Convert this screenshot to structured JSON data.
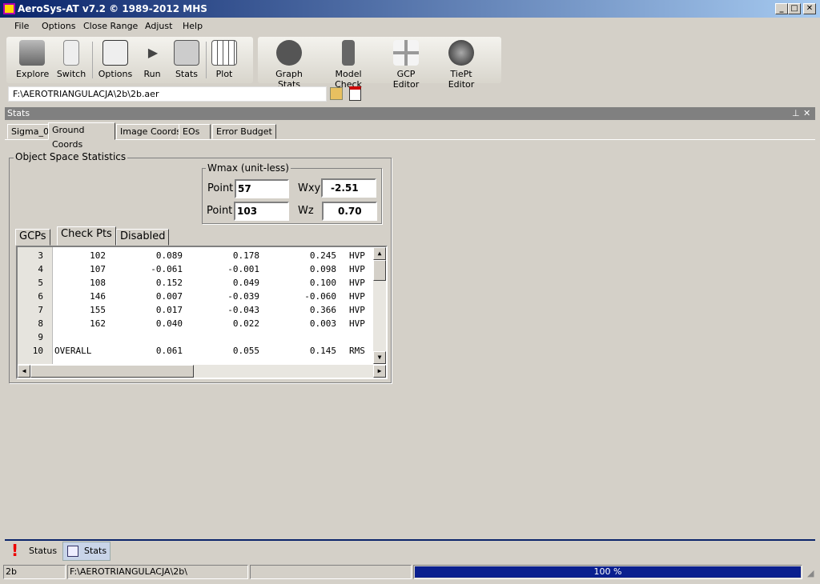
{
  "window": {
    "title": "AeroSys-AT  v7.2 © 1989-2012 MHS",
    "controls": [
      "_",
      "□",
      "✕"
    ]
  },
  "menu": [
    "File",
    "Options",
    "Close Range",
    "Adjust",
    "Help"
  ],
  "toolbar1": [
    {
      "label": "Explore",
      "icon": "computer-icon"
    },
    {
      "label": "Switch",
      "icon": "switch-icon"
    },
    {
      "label": "Options",
      "icon": "checklist-icon"
    },
    {
      "label": "Run",
      "icon": "play-icon"
    },
    {
      "label": "Stats",
      "icon": "magnifier-icon"
    },
    {
      "label": "Plot",
      "icon": "grid-icon"
    }
  ],
  "toolbar2": [
    {
      "label": "Graph Stats",
      "icon": "pie-chart-icon"
    },
    {
      "label": "Model Check",
      "icon": "shield-icon"
    },
    {
      "label": "GCP Editor",
      "icon": "crosshair-icon"
    },
    {
      "label": "TiePt Editor",
      "icon": "tiepoint-icon"
    }
  ],
  "address": "F:\\AEROTRIANGULACJA\\2b\\2b.aer",
  "panel": {
    "title": "Stats"
  },
  "tabs": [
    "Sigma_0",
    "Ground Coords",
    "Image Coords",
    "EOs",
    "Error Budget"
  ],
  "active_tab": "Ground Coords",
  "group_title": "Object Space Statistics",
  "wmax": {
    "title": "Wmax (unit-less)",
    "point_label": "Point",
    "point_xy": "57",
    "wxy_label": "Wxy",
    "wxy": "-2.51",
    "point_z": "103",
    "wz_label": "Wz",
    "wz": "0.70"
  },
  "subtabs": [
    "GCPs",
    "Check Pts",
    "Disabled"
  ],
  "active_subtab": "Check Pts",
  "rows": [
    [
      "3",
      "102",
      "0.089",
      "0.178",
      "0.245",
      "HVP"
    ],
    [
      "4",
      "107",
      "-0.061",
      "-0.001",
      "0.098",
      "HVP"
    ],
    [
      "5",
      "108",
      "0.152",
      "0.049",
      "0.100",
      "HVP"
    ],
    [
      "6",
      "146",
      "0.007",
      "-0.039",
      "-0.060",
      "HVP"
    ],
    [
      "7",
      "155",
      "0.017",
      "-0.043",
      "0.366",
      "HVP"
    ],
    [
      "8",
      "162",
      "0.040",
      "0.022",
      "0.003",
      "HVP"
    ],
    [
      "9",
      "",
      "",
      "",
      "",
      ""
    ],
    [
      "10",
      "OVERALL",
      "0.061",
      "0.055",
      "0.145",
      "RMS"
    ]
  ],
  "bottom_tabs": [
    {
      "label": "Status",
      "icon": "exclamation-icon"
    },
    {
      "label": "Stats",
      "icon": "magnifier-icon"
    }
  ],
  "status": {
    "name": "2b",
    "path": "F:\\AEROTRIANGULACJA\\2b\\",
    "empty": "",
    "progress_text": "100 %",
    "progress": 100
  },
  "colors": {
    "title": "#0a246a",
    "progress": "#0a1f8f"
  }
}
